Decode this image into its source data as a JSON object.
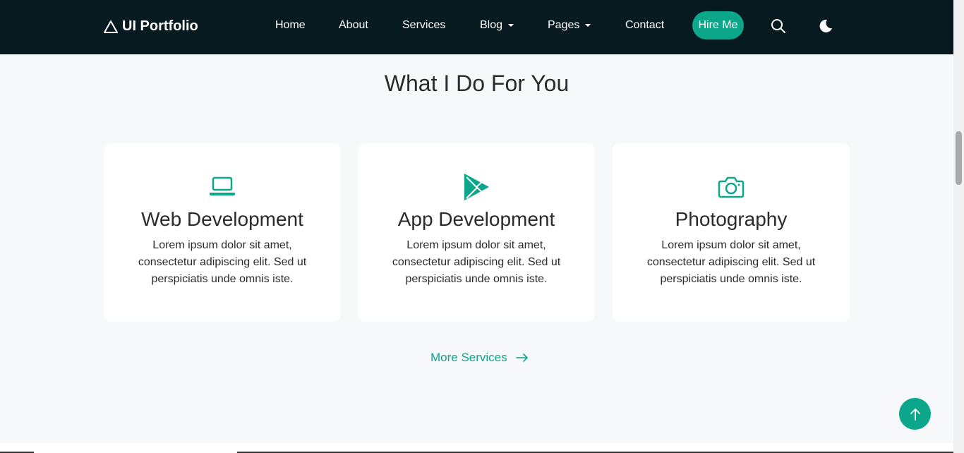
{
  "brand": {
    "name": "UI Portfolio",
    "icon": "triangle-icon"
  },
  "nav": {
    "home": "Home",
    "about": "About",
    "services": "Services",
    "blog": "Blog",
    "pages": "Pages",
    "contact": "Contact",
    "hire": "Hire Me",
    "search_icon": "search-icon",
    "theme_icon": "moon-icon"
  },
  "section": {
    "title": "What I Do For You"
  },
  "cards": [
    {
      "icon": "laptop-icon",
      "title": "Web Development",
      "desc": "Lorem ipsum dolor sit amet, consectetur adipiscing elit. Sed ut perspiciatis unde omnis iste."
    },
    {
      "icon": "play-store-icon",
      "title": "App Development",
      "desc": "Lorem ipsum dolor sit amet, consectetur adipiscing elit. Sed ut perspiciatis unde omnis iste."
    },
    {
      "icon": "camera-icon",
      "title": "Photography",
      "desc": "Lorem ipsum dolor sit amet, consectetur adipiscing elit. Sed ut perspiciatis unde omnis iste."
    }
  ],
  "more": {
    "label": "More Services",
    "icon": "arrow-right-icon"
  },
  "scroll_top": {
    "icon": "arrow-up-icon"
  },
  "colors": {
    "accent": "#0ca68a",
    "navbar": "#061a1f",
    "background": "#f6f8fa"
  }
}
